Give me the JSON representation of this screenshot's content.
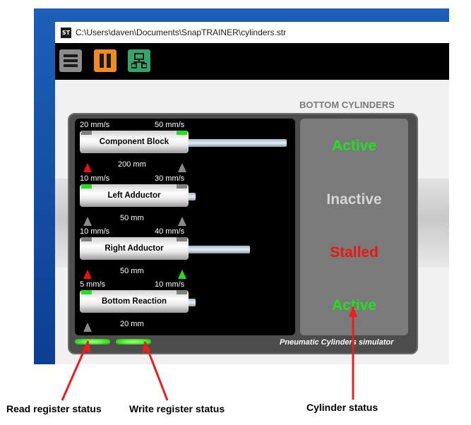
{
  "window": {
    "title": "C:\\Users\\daven\\Documents\\SnapTRAINER\\cylinders.str",
    "app_icon": "ST"
  },
  "toolbar": {
    "buttons": [
      {
        "icon": "hamburger-menu-icon",
        "color": "#8c8c8c"
      },
      {
        "icon": "pause-icon",
        "color": "#f08a24"
      },
      {
        "icon": "network-icon",
        "color": "#34a56a"
      }
    ]
  },
  "section_title": "BOTTOM CYLINDERS",
  "cylinders": [
    {
      "name": "Component Block",
      "speed_left": "20 mm/s",
      "speed_right": "50 mm/s",
      "position": "200 mm",
      "retract_lamp": "off",
      "extend_lamp": "on",
      "left_sensor": "red",
      "right_sensor": "gray",
      "status": "Active",
      "extension": 1.0
    },
    {
      "name": "Left Adductor",
      "speed_left": "10 mm/s",
      "speed_right": "30 mm/s",
      "position": "50 mm",
      "retract_lamp": "on",
      "extend_lamp": "off",
      "left_sensor": "gray",
      "right_sensor": "gray",
      "status": "Inactive",
      "extension": 0.0
    },
    {
      "name": "Right Adductor",
      "speed_left": "10 mm/s",
      "speed_right": "40 mm/s",
      "position": "50 mm",
      "retract_lamp": "off",
      "extend_lamp": "off",
      "left_sensor": "red",
      "right_sensor": "green",
      "status": "Stalled",
      "extension": 0.6
    },
    {
      "name": "Bottom Reaction",
      "speed_left": "5 mm/s",
      "speed_right": "10 mm/s",
      "position": "20 mm",
      "retract_lamp": "on",
      "extend_lamp": "off",
      "left_sensor": "gray",
      "right_sensor": "none",
      "status": "Active",
      "extension": 0.0
    }
  ],
  "status_colors": {
    "Active": "#22e01e",
    "Inactive": "#d6d6d6",
    "Stalled": "#ea1616"
  },
  "simulator_label": "Pneumatic Cylinders simulator",
  "annotations": {
    "read": "Read register status",
    "write": "Write register status",
    "cylinder": "Cylinder status"
  }
}
